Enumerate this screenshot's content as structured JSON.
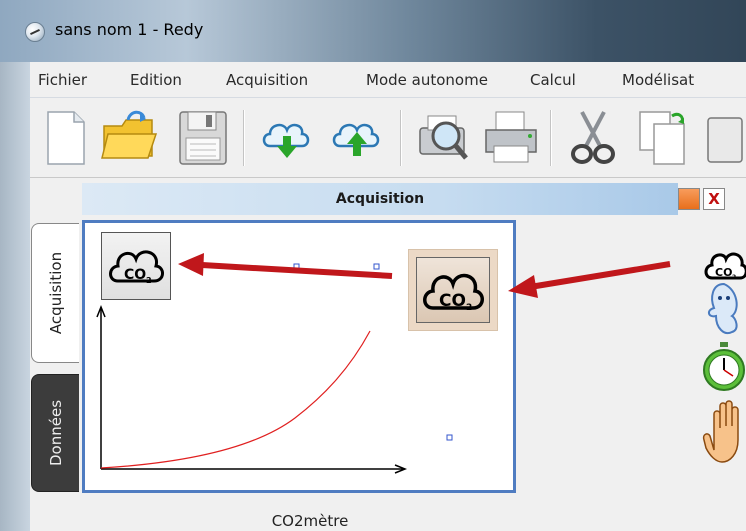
{
  "window": {
    "title": "sans nom 1 - Redy"
  },
  "menu": {
    "items": [
      "Fichier",
      "Edition",
      "Acquisition",
      "Mode autonome",
      "Calcul",
      "Modélisat"
    ]
  },
  "toolbar": {
    "buttons": [
      "new-file-icon",
      "open-folder-icon",
      "save-disk-icon",
      "download-cloud-icon",
      "upload-cloud-icon",
      "print-preview-icon",
      "print-icon",
      "cut-icon",
      "copy-icon"
    ]
  },
  "side_tabs": {
    "acquisition": "Acquisition",
    "donnees": "Données"
  },
  "panel": {
    "title": "Acquisition",
    "close_label": "X"
  },
  "sensor": {
    "label": "CO2mètre",
    "icon_text": "CO",
    "icon_sub": "2"
  },
  "colors": {
    "frame_border": "#4f7cc1",
    "arrow": "#c0171b",
    "curve": "#e02020",
    "marker": "#3355cc"
  },
  "right_palette": [
    "co2-sensor-icon",
    "ghost-icon",
    "stopwatch-icon",
    "hand-icon"
  ]
}
